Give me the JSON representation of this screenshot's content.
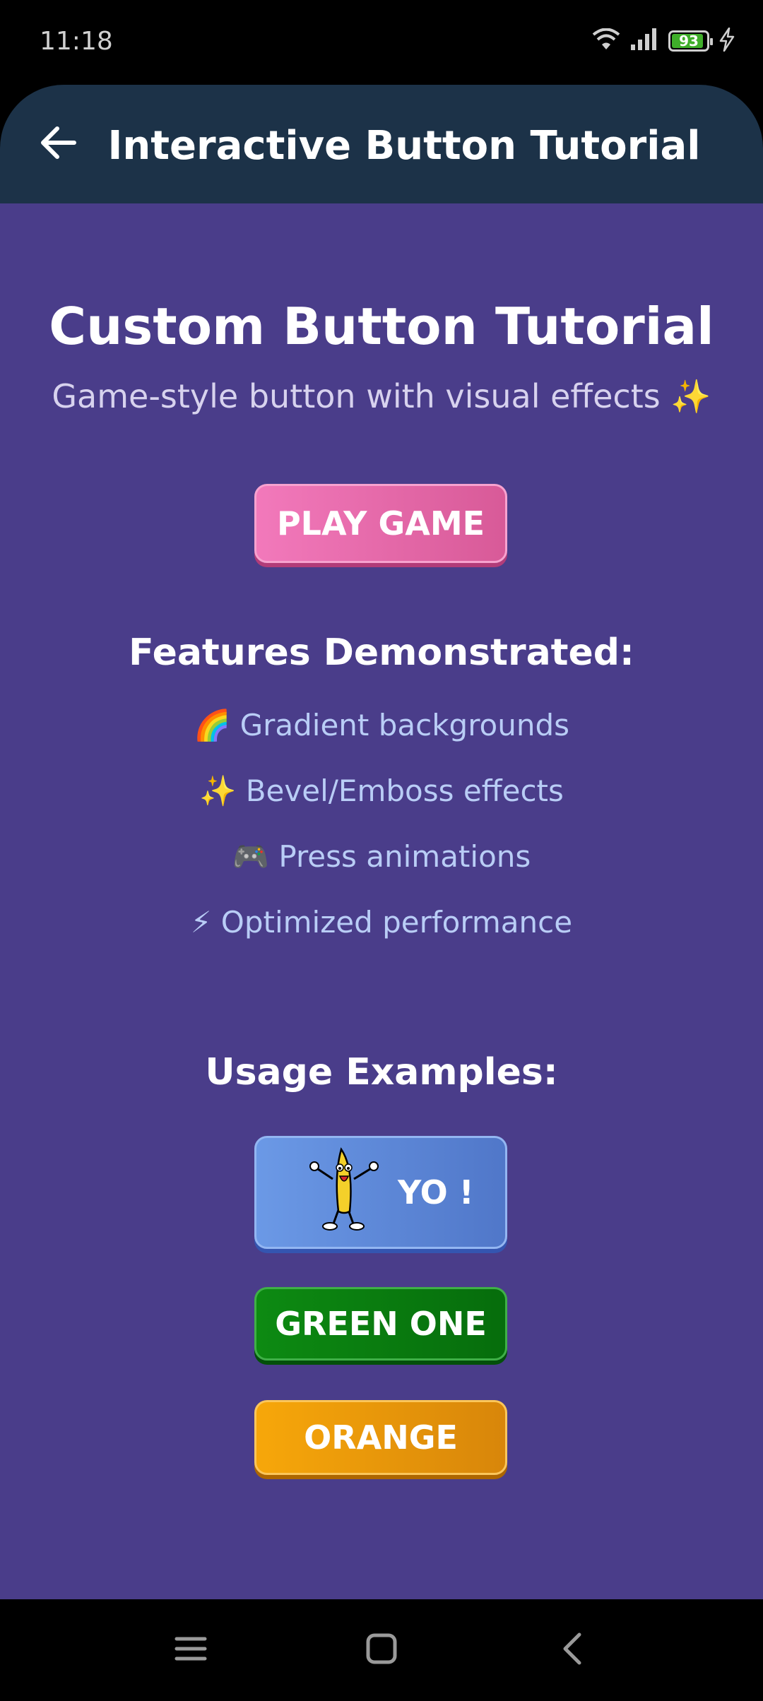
{
  "status_bar": {
    "time": "11:18",
    "battery_level": "93",
    "battery_fraction": 0.93,
    "icons": [
      "wifi-icon",
      "signal-icon",
      "battery-icon",
      "charging-icon"
    ]
  },
  "app_bar": {
    "title": "Interactive Button Tutorial",
    "back_icon": "arrow-left-icon"
  },
  "main": {
    "title": "Custom Button Tutorial",
    "subtitle": "Game-style button with visual effects ✨",
    "play_button": "PLAY GAME",
    "features_title": "Features Demonstrated:",
    "features": [
      "🌈 Gradient backgrounds",
      "✨ Bevel/Emboss effects",
      "🎮 Press animations",
      "⚡ Optimized performance"
    ],
    "usage_title": "Usage Examples:",
    "yo_button": "YO !",
    "yo_image": "dancing-banana-icon",
    "green_button": "GREEN ONE",
    "orange_button": "ORANGE"
  },
  "nav_bar": {
    "icons": [
      "menu-icon",
      "home-icon",
      "back-icon"
    ]
  },
  "colors": {
    "background": "#4a3d8a",
    "app_bar": "#1c3248",
    "play_button": "#e668a8",
    "yo_button": "#5f8ad9",
    "green_button": "#0a7d10",
    "orange_button": "#ee9a0a",
    "feature_text": "#b9cdf6"
  }
}
